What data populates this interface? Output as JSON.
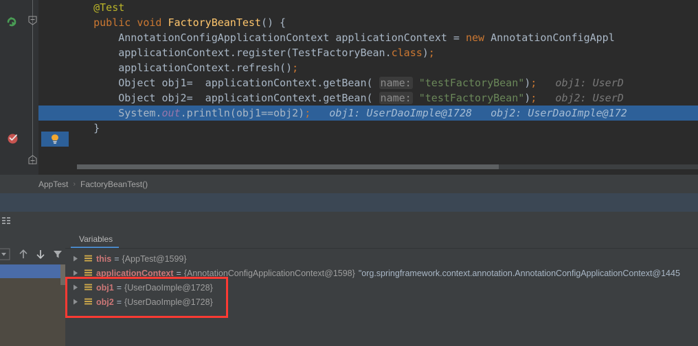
{
  "editor": {
    "lines": [
      {
        "indent": 1,
        "tokens": [
          {
            "t": "@Test",
            "c": "t-anno"
          }
        ]
      },
      {
        "indent": 1,
        "tokens": [
          {
            "t": "public",
            "c": "t-kw"
          },
          {
            "t": " ",
            "c": "t-id"
          },
          {
            "t": "void",
            "c": "t-kw"
          },
          {
            "t": " ",
            "c": "t-id"
          },
          {
            "t": "FactoryBeanTest",
            "c": "t-method"
          },
          {
            "t": "() {",
            "c": "t-punc"
          }
        ]
      },
      {
        "indent": 2,
        "tokens": [
          {
            "t": "AnnotationConfigApplicationContext applicationContext = ",
            "c": "t-id"
          },
          {
            "t": "new",
            "c": "t-kw"
          },
          {
            "t": " AnnotationConfigAppl",
            "c": "t-id"
          }
        ]
      },
      {
        "indent": 2,
        "tokens": [
          {
            "t": "applicationContext.register(TestFactoryBean.",
            "c": "t-id"
          },
          {
            "t": "class",
            "c": "t-kw"
          },
          {
            "t": ")",
            "c": "t-id"
          },
          {
            "t": ";",
            "c": "t-semi"
          }
        ]
      },
      {
        "indent": 2,
        "tokens": [
          {
            "t": "applicationContext.refresh()",
            "c": "t-id"
          },
          {
            "t": ";",
            "c": "t-semi"
          }
        ]
      },
      {
        "indent": 2,
        "tokens": [
          {
            "t": "Object obj1=  applicationContext.getBean( ",
            "c": "t-id"
          },
          {
            "t": "name:",
            "c": "param-hint"
          },
          {
            "t": " ",
            "c": "t-id"
          },
          {
            "t": "\"testFactoryBean\"",
            "c": "t-str"
          },
          {
            "t": ")",
            "c": "t-id"
          },
          {
            "t": ";",
            "c": "t-semi"
          },
          {
            "t": "   obj1: UserD",
            "c": "t-hint"
          }
        ]
      },
      {
        "indent": 2,
        "tokens": [
          {
            "t": "Object obj2=  applicationContext.getBean( ",
            "c": "t-id"
          },
          {
            "t": "name:",
            "c": "param-hint"
          },
          {
            "t": " ",
            "c": "t-id"
          },
          {
            "t": "\"testFactoryBean\"",
            "c": "t-str"
          },
          {
            "t": ")",
            "c": "t-id"
          },
          {
            "t": ";",
            "c": "t-semi"
          },
          {
            "t": "   obj2: UserD",
            "c": "t-hint"
          }
        ]
      },
      {
        "indent": 2,
        "selected": true,
        "tokens": [
          {
            "t": "System.",
            "c": "t-id"
          },
          {
            "t": "out",
            "c": "t-static"
          },
          {
            "t": ".println(obj1==obj2)",
            "c": "t-id"
          },
          {
            "t": ";",
            "c": "t-semi"
          },
          {
            "t": "   obj1: UserDaoImple@1728   obj2: UserDaoImple@172",
            "c": "t-hint-sel"
          }
        ]
      },
      {
        "indent": 1,
        "tokens": [
          {
            "t": "}",
            "c": "t-punc"
          }
        ]
      }
    ],
    "gutter_run_icon": "run-test-icon",
    "gutter_breakpoint_icon": "breakpoint-verified-icon",
    "intention_bulb_icon": "lightbulb-icon",
    "fold_top_icon": "fold-region-icon",
    "fold_bottom_icon": "fold-region-icon"
  },
  "breadcrumb": {
    "items": [
      "AppTest",
      "FactoryBeanTest()"
    ],
    "separator": "›"
  },
  "toolstrip": {
    "wrap_icon": "soft-wrap-icon"
  },
  "frames_panel": {
    "toolbar_icons": [
      "chevron-down-icon",
      "arrow-up-icon",
      "arrow-down-icon",
      "filter-icon"
    ]
  },
  "variables_panel": {
    "tab_label": "Variables",
    "rows": [
      {
        "expander": "triangle-right-icon",
        "icon": "object-value-icon",
        "name": "this",
        "eq": "=",
        "value": "{AppTest@1599}",
        "str": ""
      },
      {
        "expander": "triangle-right-icon",
        "icon": "object-value-icon",
        "name": "applicationContext",
        "eq": "=",
        "value": "{AnnotationConfigApplicationContext@1598}",
        "str": "\"org.springframework.context.annotation.AnnotationConfigApplicationContext@1445"
      },
      {
        "expander": "triangle-right-icon",
        "icon": "object-value-icon",
        "name": "obj1",
        "eq": "=",
        "value": "{UserDaoImple@1728}",
        "str": ""
      },
      {
        "expander": "triangle-right-icon",
        "icon": "object-value-icon",
        "name": "obj2",
        "eq": "=",
        "value": "{UserDaoImple@1728}",
        "str": ""
      }
    ]
  },
  "annotation": {
    "highlight_color": "#fc3a33",
    "highlight_name": "red-highlight-rectangle"
  },
  "colors": {
    "editor_bg": "#2b2b2b",
    "panel_bg": "#3c3f41",
    "selection_blue": "#2d6099",
    "tab_accent": "#4a88c7",
    "var_name": "#cc7777",
    "string_green": "#6a8759",
    "keyword_orange": "#cc7832",
    "method_yellow": "#ffc66d"
  }
}
